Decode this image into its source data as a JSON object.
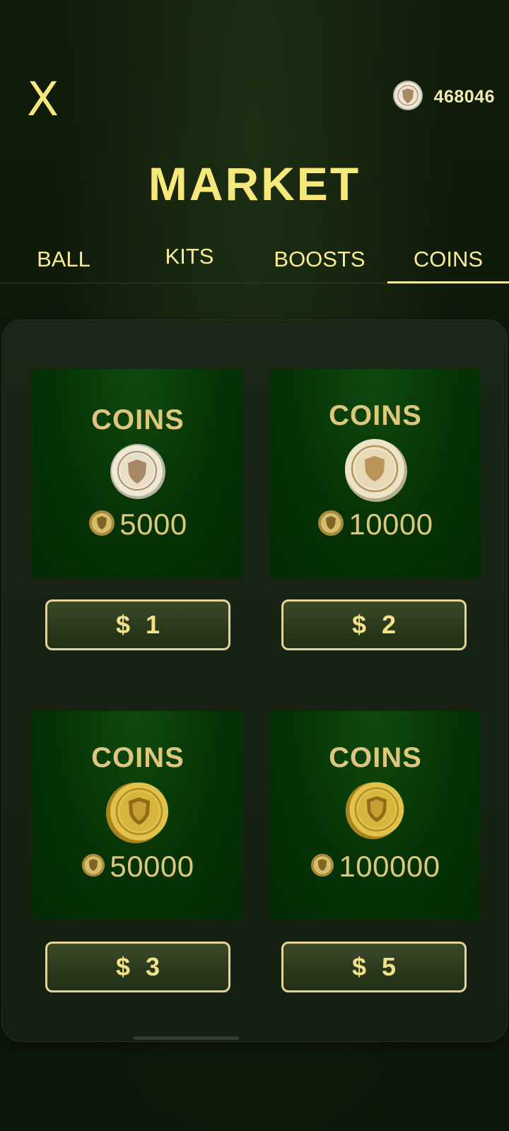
{
  "header": {
    "close_label": "X",
    "balance": "468046",
    "title": "MARKET"
  },
  "tabs": [
    {
      "label": "BALL",
      "active": false
    },
    {
      "label": "KITS",
      "active": false
    },
    {
      "label": "BOOSTS",
      "active": false
    },
    {
      "label": "COINS",
      "active": true
    }
  ],
  "packs": [
    {
      "title": "COINS",
      "amount": "5000",
      "price_symbol": "$",
      "price": "1",
      "coin_style": "silver"
    },
    {
      "title": "COINS",
      "amount": "10000",
      "price_symbol": "$",
      "price": "2",
      "coin_style": "silver-large"
    },
    {
      "title": "COINS",
      "amount": "50000",
      "price_symbol": "$",
      "price": "3",
      "coin_style": "gold"
    },
    {
      "title": "COINS",
      "amount": "100000",
      "price_symbol": "$",
      "price": "5",
      "coin_style": "gold"
    }
  ],
  "colors": {
    "accent": "#f6e87a",
    "card_bg": "#063306",
    "button_border": "#e4d49a"
  }
}
